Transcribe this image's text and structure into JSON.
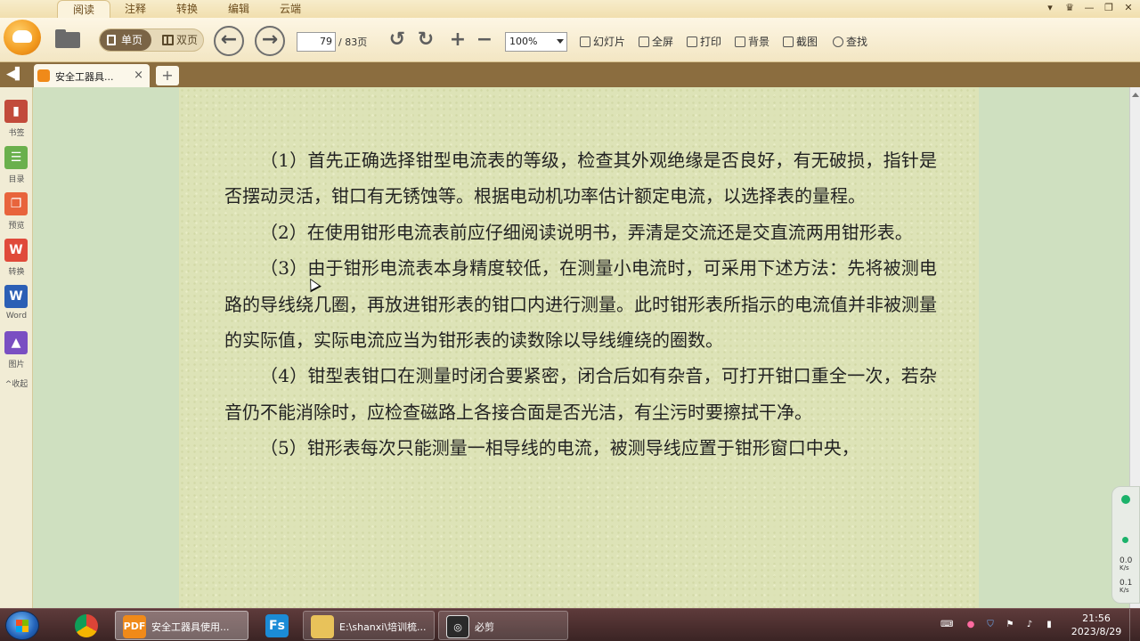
{
  "top_menu": {
    "tabs": [
      "阅读",
      "注释",
      "转换",
      "编辑",
      "云端"
    ],
    "active_index": 0
  },
  "toolbar": {
    "view_single": "单页",
    "view_double": "双页",
    "current_page": "79",
    "total_pages": "/ 83页",
    "zoom": "100%",
    "buttons": [
      "幻灯片",
      "全屏",
      "打印",
      "背景",
      "截图",
      "查找"
    ]
  },
  "doc_tab": {
    "title": "安全工器具...",
    "close": "×",
    "new_tab": "+"
  },
  "sidebar": {
    "items": [
      {
        "label": "书签",
        "icon": "bookmark-icon",
        "color": "#c24b3b"
      },
      {
        "label": "目录",
        "icon": "toc-icon",
        "color": "#6ab04c"
      },
      {
        "label": "预览",
        "icon": "preview-icon",
        "color": "#e8643c"
      },
      {
        "label": "转换",
        "icon": "pdf-to-word-icon",
        "color": "#e04a3a"
      },
      {
        "label": "Word",
        "icon": "word-icon",
        "color": "#2b5fb5"
      },
      {
        "label": "图片",
        "icon": "picture-icon",
        "color": "#7a4fc2"
      }
    ],
    "collapse": "^收起"
  },
  "document": {
    "paragraphs": [
      "（1）首先正确选择钳型电流表的等级，检查其外观绝缘是否良好，有无破损，指针是否摆动灵活，钳口有无锈蚀等。根据电动机功率估计额定电流，以选择表的量程。",
      "（2）在使用钳形电流表前应仔细阅读说明书，弄清是交流还是交直流两用钳形表。",
      "（3）由于钳形电流表本身精度较低，在测量小电流时，可采用下述方法：先将被测电路的导线绕几圈，再放进钳形表的钳口内进行测量。此时钳形表所指示的电流值并非被测量的实际值，实际电流应当为钳形表的读数除以导线缠绕的圈数。",
      "（4）钳型表钳口在测量时闭合要紧密，闭合后如有杂音，可打开钳口重全一次，若杂音仍不能消除时，应检查磁路上各接合面是否光洁，有尘污时要擦拭干净。",
      "（5）钳形表每次只能测量一相导线的电流，被测导线应置于钳形窗口中央，"
    ]
  },
  "net_widget": {
    "up": "0.0",
    "down": "0.1",
    "unit": "K/s"
  },
  "taskbar": {
    "items": [
      {
        "label": "",
        "icon": "chrome-icon"
      },
      {
        "label": "安全工器具使用...",
        "icon": "pdf-reader-icon"
      },
      {
        "label": "",
        "icon": "fs-icon",
        "icon_text": "Fs"
      },
      {
        "label": "E:\\shanxi\\培训梳...",
        "icon": "folder-icon"
      },
      {
        "label": "必剪",
        "icon": "bijian-icon"
      }
    ],
    "time": "21:56",
    "date": "2023/8/29"
  }
}
